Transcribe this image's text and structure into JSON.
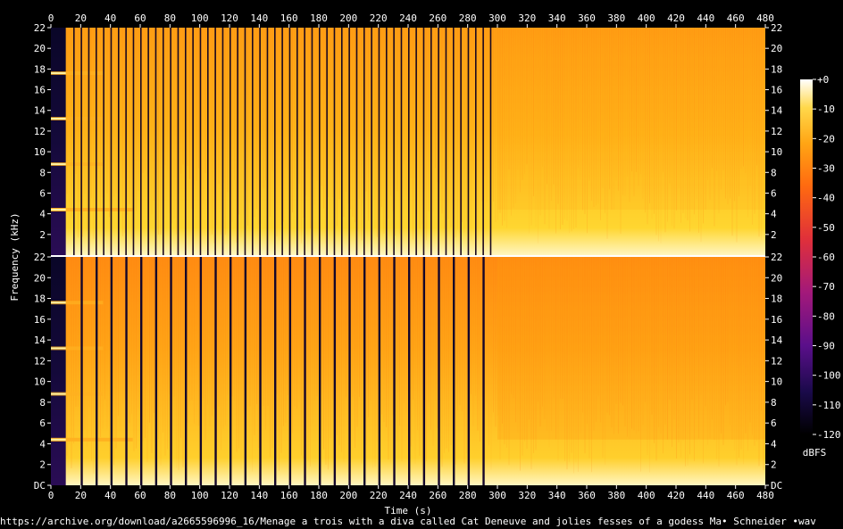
{
  "chart_data": {
    "type": "heatmap",
    "title": "",
    "xlabel": "Time (s)",
    "ylabel": "Frequency (kHz)",
    "xlim": [
      0,
      480
    ],
    "x_ticks": [
      0,
      20,
      40,
      60,
      80,
      100,
      120,
      140,
      160,
      180,
      200,
      220,
      240,
      260,
      280,
      300,
      320,
      340,
      360,
      380,
      400,
      420,
      440,
      460,
      480
    ],
    "channels": [
      {
        "name": "",
        "ylim": [
          0,
          22
        ],
        "y_ticks": [
          2,
          4,
          6,
          8,
          10,
          12,
          14,
          16,
          18,
          20,
          22
        ],
        "y_tick_labels": [
          "2",
          "4",
          "6",
          "8",
          "10",
          "12",
          "14",
          "16",
          "18",
          "20",
          "22"
        ]
      },
      {
        "name": "",
        "ylim": [
          0,
          22
        ],
        "y_ticks": [
          0,
          2,
          4,
          6,
          8,
          10,
          12,
          14,
          16,
          18,
          20,
          22
        ],
        "y_tick_labels": [
          "DC",
          "2",
          "4",
          "6",
          "8",
          "10",
          "12",
          "14",
          "16",
          "18",
          "20",
          "22"
        ]
      }
    ],
    "intro_tone_end_s": 10,
    "gap_region_end_s": 300,
    "colorbar": {
      "label": "dBFS",
      "range": [
        -120,
        0
      ],
      "ticks": [
        0,
        -10,
        -20,
        -30,
        -40,
        -50,
        -60,
        -70,
        -80,
        -90,
        -100,
        -110,
        -120
      ],
      "tick_labels": [
        "+0",
        "-10",
        "-20",
        "-30",
        "-40",
        "-50",
        "-60",
        "-70",
        "-80",
        "-90",
        "-100",
        "-110",
        "-120"
      ],
      "colormap": [
        "#000000",
        "#1a0a4a",
        "#5a0f8a",
        "#a3197a",
        "#e0303a",
        "#ff6a10",
        "#ffa514",
        "#ffd84a",
        "#ffffff"
      ]
    },
    "source": "https://archive.org/download/a2665596996_16/Menage a trois with a diva called Cat Deneuve and jolies fesses of a godess Ma• Schneider •wav"
  }
}
